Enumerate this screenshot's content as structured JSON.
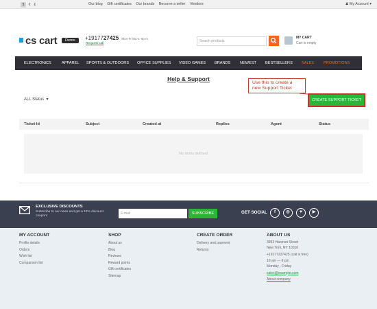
{
  "topbar": {
    "currencies": [
      "$",
      "€",
      "£"
    ],
    "links": [
      "Our blog",
      "Gift certificates",
      "Our brands",
      "Become a seller",
      "Vendors"
    ],
    "account": "My Account"
  },
  "header": {
    "logo": "cs cart",
    "demo_badge": "Demo",
    "phone_prefix": "+19177",
    "phone_bold": "27425",
    "hours": "Mon-Fr 9a.m.-6p.m.",
    "request_call": "Request call",
    "search_placeholder": "Search products",
    "cart_title": "MY CART",
    "cart_status": "Cart is empty"
  },
  "nav": [
    "ELECTRONICS",
    "APPAREL",
    "SPORTS & OUTDOORS",
    "OFFICE SUPPLIES",
    "VIDEO GAMES",
    "BRANDS",
    "NEWEST",
    "BESTSELLERS",
    "SALES",
    "PROMOTIONS"
  ],
  "page": {
    "title": "Help & Support",
    "callout": "Use this to create a new Support Ticket",
    "filter": "ALL Status",
    "create_button": "CREATE SUPPORT TICKET",
    "columns": [
      "Ticket-Id",
      "Subject",
      "Created at",
      "Replies",
      "Agent",
      "Status"
    ],
    "empty_text": "No items defined"
  },
  "newsletter": {
    "title": "EXCLUSIVE DISCOUNTS",
    "subtitle": "Subscribe to our news and get a 10% discount coupon!",
    "email_placeholder": "E-mail",
    "subscribe": "SUBSCRIBE",
    "social_label": "GET SOCIAL"
  },
  "footer": {
    "account": {
      "title": "MY ACCOUNT",
      "links": [
        "Profile details",
        "Orders",
        "Wish list",
        "Comparison list"
      ]
    },
    "shop": {
      "title": "SHOP",
      "links": [
        "About us",
        "Blog",
        "Reviews",
        "Reward points",
        "Gift certificates",
        "Sitemap"
      ]
    },
    "order": {
      "title": "CREATE ORDER",
      "links": [
        "Delivery and payment",
        "Returns"
      ]
    },
    "about": {
      "title": "ABOUT US",
      "address1": "3993 Hanover Street",
      "address2": "New York, NY 10016",
      "phone": "+19177227425 (call is free)",
      "hours1": "10 am — 6 pm",
      "hours2": "Monday - Friday",
      "email": "sales@example.com",
      "company": "About company"
    }
  }
}
